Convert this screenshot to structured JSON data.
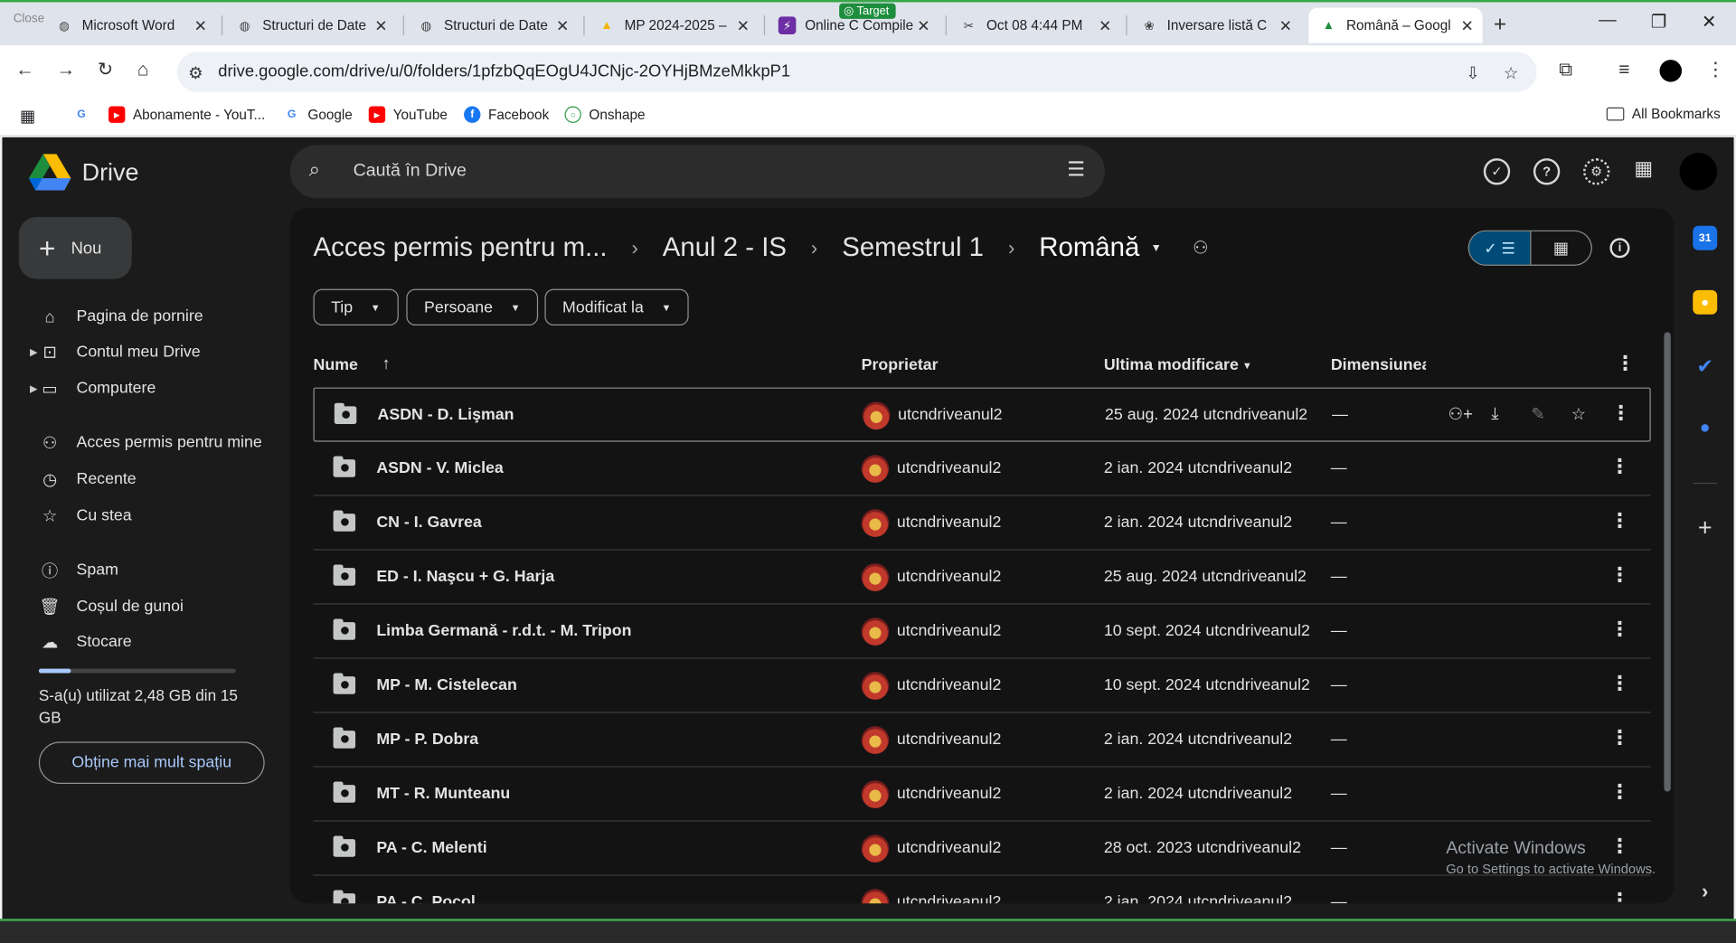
{
  "browser": {
    "close_hint": "Close",
    "target_badge": "Target",
    "tabs": [
      {
        "title": "Microsoft Word",
        "icon": "globe-icon"
      },
      {
        "title": "Structuri de Date",
        "icon": "globe-icon"
      },
      {
        "title": "Structuri de Date",
        "icon": "globe-icon"
      },
      {
        "title": "MP 2024-2025 –",
        "icon": "drive-icon"
      },
      {
        "title": "Online C Compile",
        "icon": "bolt-icon"
      },
      {
        "title": "Oct 08 4:44 PM",
        "icon": "tool-icon"
      },
      {
        "title": "Inversare listă C",
        "icon": "ai-icon"
      },
      {
        "title": "Română – Googl",
        "icon": "drive-icon"
      }
    ],
    "url": "drive.google.com/drive/u/0/folders/1pfzbQqEOgU4JCNjc-2OYHjBMzeMkkpP1",
    "bookmarks": [
      {
        "label": "",
        "icon": "google-icon"
      },
      {
        "label": "Abonamente - YouT...",
        "icon": "youtube-icon"
      },
      {
        "label": "Google",
        "icon": "google-icon"
      },
      {
        "label": "YouTube",
        "icon": "youtube-icon"
      },
      {
        "label": "Facebook",
        "icon": "facebook-icon"
      },
      {
        "label": "Onshape",
        "icon": "onshape-icon"
      }
    ],
    "all_bookmarks": "All Bookmarks"
  },
  "drive": {
    "logo_text": "Drive",
    "search_placeholder": "Caută în Drive",
    "new_button": "Nou",
    "nav": [
      {
        "label": "Pagina de pornire",
        "icon": "home-icon"
      },
      {
        "label": "Contul meu Drive",
        "icon": "my-drive-icon"
      },
      {
        "label": "Computere",
        "icon": "computer-icon"
      },
      {
        "label": "Acces permis pentru mine",
        "icon": "shared-icon"
      },
      {
        "label": "Recente",
        "icon": "clock-icon"
      },
      {
        "label": "Cu stea",
        "icon": "star-icon"
      },
      {
        "label": "Spam",
        "icon": "spam-icon"
      },
      {
        "label": "Coșul de gunoi",
        "icon": "trash-icon"
      },
      {
        "label": "Stocare",
        "icon": "cloud-icon"
      }
    ],
    "storage_text": "S-a(u) utilizat 2,48 GB din 15 GB",
    "storage_used_fraction": 0.165,
    "more_space": "Obține mai mult spațiu",
    "breadcrumb": [
      "Acces permis pentru m...",
      "Anul 2 - IS",
      "Semestrul 1",
      "Română"
    ],
    "filters": [
      "Tip",
      "Persoane",
      "Modificat la"
    ],
    "columns": {
      "name": "Nume",
      "owner": "Proprietar",
      "modified": "Ultima modificare",
      "size": "Dimensiunea"
    },
    "rows": [
      {
        "name": "ASDN - D.  Lişman",
        "owner": "utcndriveanul2",
        "modified": "25 aug. 2024 utcndriveanul2",
        "size": "—"
      },
      {
        "name": "ASDN - V. Miclea",
        "owner": "utcndriveanul2",
        "modified": "2 ian. 2024 utcndriveanul2",
        "size": "—"
      },
      {
        "name": "CN - I. Gavrea",
        "owner": "utcndriveanul2",
        "modified": "2 ian. 2024 utcndriveanul2",
        "size": "—"
      },
      {
        "name": "ED - I. Naşcu + G. Harja",
        "owner": "utcndriveanul2",
        "modified": "25 aug. 2024 utcndriveanul2",
        "size": "—"
      },
      {
        "name": "Limba Germană - r.d.t. - M. Tripon",
        "owner": "utcndriveanul2",
        "modified": "10 sept. 2024 utcndriveanul2",
        "size": "—"
      },
      {
        "name": "MP - M. Cistelecan",
        "owner": "utcndriveanul2",
        "modified": "10 sept. 2024 utcndriveanul2",
        "size": "—"
      },
      {
        "name": "MP - P. Dobra",
        "owner": "utcndriveanul2",
        "modified": "2 ian. 2024 utcndriveanul2",
        "size": "—"
      },
      {
        "name": "MT - R. Munteanu",
        "owner": "utcndriveanul2",
        "modified": "2 ian. 2024 utcndriveanul2",
        "size": "—"
      },
      {
        "name": "PA - C. Melenti",
        "owner": "utcndriveanul2",
        "modified": "28 oct. 2023 utcndriveanul2",
        "size": "—"
      },
      {
        "name": "PA - C. Pocol",
        "owner": "utcndriveanul2",
        "modified": "2 ian. 2024 utcndriveanul2",
        "size": "—"
      }
    ]
  },
  "watermark": {
    "line1": "Activate Windows",
    "line2": "Go to Settings to activate Windows."
  },
  "colors": {
    "accent": "#a8c7fa",
    "selected_view": "#004a77",
    "background": "#1b1b1b",
    "panel": "#131314"
  }
}
